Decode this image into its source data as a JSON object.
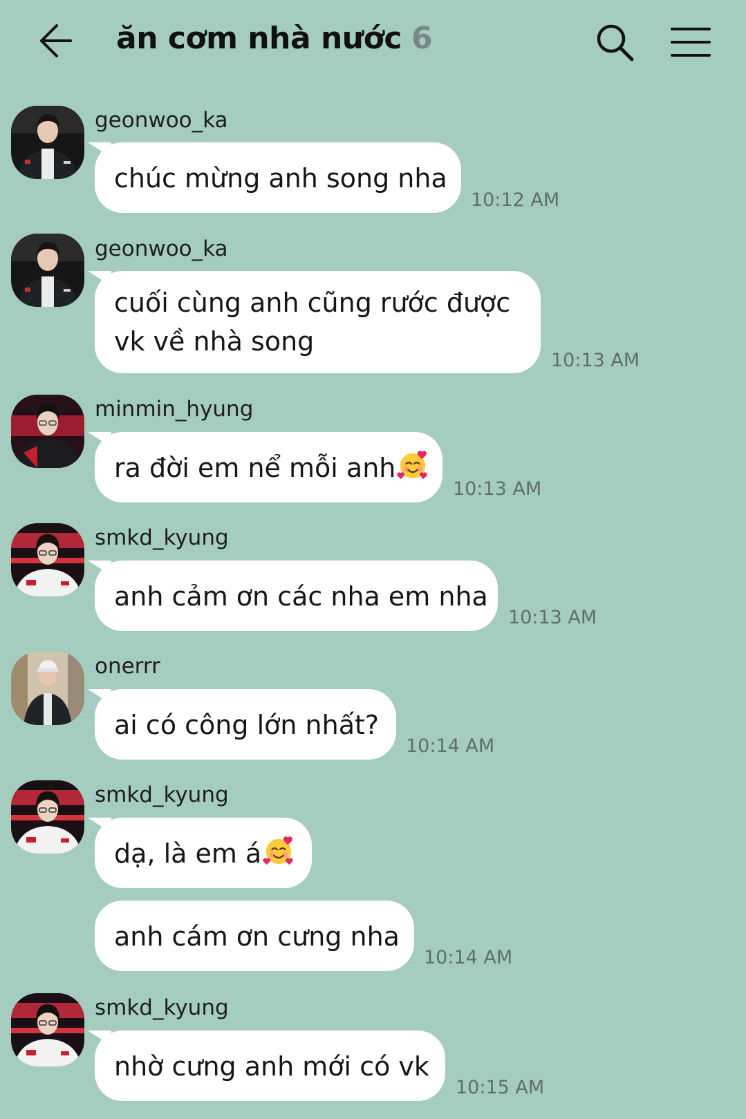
{
  "header": {
    "title": "ăn cơm nhà nước",
    "member_count": "6",
    "icons": [
      "back-arrow-icon",
      "search-icon",
      "menu-icon"
    ]
  },
  "colors": {
    "background": "#a5cdbf",
    "bubble": "#ffffff",
    "count": "#79878a"
  },
  "messages": [
    {
      "sender": "geonwoo_ka",
      "lines": [
        "chúc mừng anh song nha"
      ],
      "time": "10:12 AM"
    },
    {
      "sender": "geonwoo_ka",
      "lines": [
        "cuối cùng anh cũng rước được",
        "vk về nhà song"
      ],
      "time": "10:13 AM"
    },
    {
      "sender": "minmin_hyung",
      "lines": [
        "ra đời em nể mỗi anh"
      ],
      "emoji": "smiling-face-with-hearts",
      "time": "10:13 AM"
    },
    {
      "sender": "smkd_kyung",
      "lines": [
        "anh cảm ơn các nha em nha"
      ],
      "time": "10:13 AM"
    },
    {
      "sender": "onerrr",
      "lines": [
        "ai có công lớn nhất?"
      ],
      "time": "10:14 AM"
    },
    {
      "sender": "smkd_kyung",
      "lines": [
        "dạ, là em á"
      ],
      "emoji": "smiling-face-with-hearts"
    },
    {
      "lines": [
        "anh cám ơn cưng nha"
      ],
      "time": "10:14 AM"
    },
    {
      "sender": "smkd_kyung",
      "lines": [
        "nhờ cưng anh mới có vk"
      ],
      "time": "10:15 AM"
    }
  ]
}
